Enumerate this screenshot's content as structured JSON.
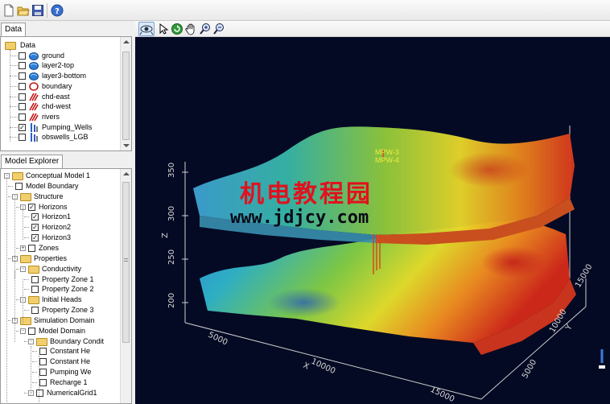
{
  "toolbar": {
    "buttons": [
      {
        "name": "new-file-icon"
      },
      {
        "name": "open-folder-icon"
      },
      {
        "name": "save-icon"
      },
      {
        "name": "help-icon"
      }
    ]
  },
  "data_panel": {
    "tab": "Data",
    "root": "Data",
    "items": [
      {
        "label": "ground",
        "checked": false,
        "icon": "surface-icon"
      },
      {
        "label": "layer2-top",
        "checked": false,
        "icon": "surface-icon"
      },
      {
        "label": "layer3-bottom",
        "checked": false,
        "icon": "surface-icon"
      },
      {
        "label": "boundary",
        "checked": false,
        "icon": "polygon-icon"
      },
      {
        "label": "chd-east",
        "checked": false,
        "icon": "polyline-icon"
      },
      {
        "label": "chd-west",
        "checked": false,
        "icon": "polyline-icon"
      },
      {
        "label": "rivers",
        "checked": false,
        "icon": "polyline-icon"
      },
      {
        "label": "Pumping_Wells",
        "checked": true,
        "icon": "wells-icon"
      },
      {
        "label": "obswells_LGB",
        "checked": false,
        "icon": "wells-icon"
      }
    ]
  },
  "model_panel": {
    "tab": "Model Explorer",
    "items": [
      {
        "label": "Conceptual Model 1",
        "indent": 0,
        "type": "folder",
        "expander": "-"
      },
      {
        "label": "Model Boundary",
        "indent": 1,
        "type": "check",
        "checked": false
      },
      {
        "label": "Structure",
        "indent": 1,
        "type": "folder",
        "expander": "-"
      },
      {
        "label": "Horizons",
        "indent": 2,
        "type": "check",
        "checked": true,
        "expander": "-"
      },
      {
        "label": "Horizon1",
        "indent": 3,
        "type": "check",
        "checked": true
      },
      {
        "label": "Horizon2",
        "indent": 3,
        "type": "check",
        "checked": true
      },
      {
        "label": "Horizon3",
        "indent": 3,
        "type": "check",
        "checked": true
      },
      {
        "label": "Zones",
        "indent": 2,
        "type": "check",
        "checked": false,
        "expander": "+"
      },
      {
        "label": "Properties",
        "indent": 1,
        "type": "folder",
        "expander": "-"
      },
      {
        "label": "Conductivity",
        "indent": 2,
        "type": "folder",
        "expander": "-"
      },
      {
        "label": "Property Zone 1",
        "indent": 3,
        "type": "check",
        "checked": false
      },
      {
        "label": "Property Zone 2",
        "indent": 3,
        "type": "check",
        "checked": false
      },
      {
        "label": "Initial Heads",
        "indent": 2,
        "type": "folder",
        "expander": "-"
      },
      {
        "label": "Property Zone 3",
        "indent": 3,
        "type": "check",
        "checked": false
      },
      {
        "label": "Simulation Domain",
        "indent": 1,
        "type": "folder",
        "expander": "-"
      },
      {
        "label": "Model Domain",
        "indent": 2,
        "type": "check",
        "checked": false,
        "expander": "-"
      },
      {
        "label": "Boundary Condit",
        "indent": 3,
        "type": "folder",
        "expander": "-"
      },
      {
        "label": "Constant He",
        "indent": 4,
        "type": "check",
        "checked": false
      },
      {
        "label": "Constant He",
        "indent": 4,
        "type": "check",
        "checked": false
      },
      {
        "label": "Pumping We",
        "indent": 4,
        "type": "check",
        "checked": false
      },
      {
        "label": "Recharge 1",
        "indent": 4,
        "type": "check",
        "checked": false
      },
      {
        "label": "NumericalGrid1",
        "indent": 3,
        "type": "check",
        "checked": false,
        "expander": "-"
      }
    ]
  },
  "view_toolbar": {
    "buttons": [
      {
        "name": "eye-view-icon"
      },
      {
        "name": "pointer-icon"
      },
      {
        "name": "rotate-icon"
      },
      {
        "name": "pan-hand-icon"
      },
      {
        "name": "zoom-in-icon"
      },
      {
        "name": "zoom-out-icon"
      }
    ]
  },
  "viewport": {
    "z_axis": {
      "label": "Z",
      "ticks": [
        "350",
        "300",
        "250",
        "200"
      ]
    },
    "x_axis": {
      "label": "X",
      "ticks": [
        "5000",
        "10000",
        "15000"
      ]
    },
    "y_axis": {
      "label": "Y",
      "ticks": [
        "5000",
        "10000",
        "15000"
      ]
    },
    "well_labels": [
      "MPW-3",
      "MPW-4"
    ],
    "watermark_cn": "机电教程园",
    "watermark_url": "www.jdjcy.com"
  }
}
